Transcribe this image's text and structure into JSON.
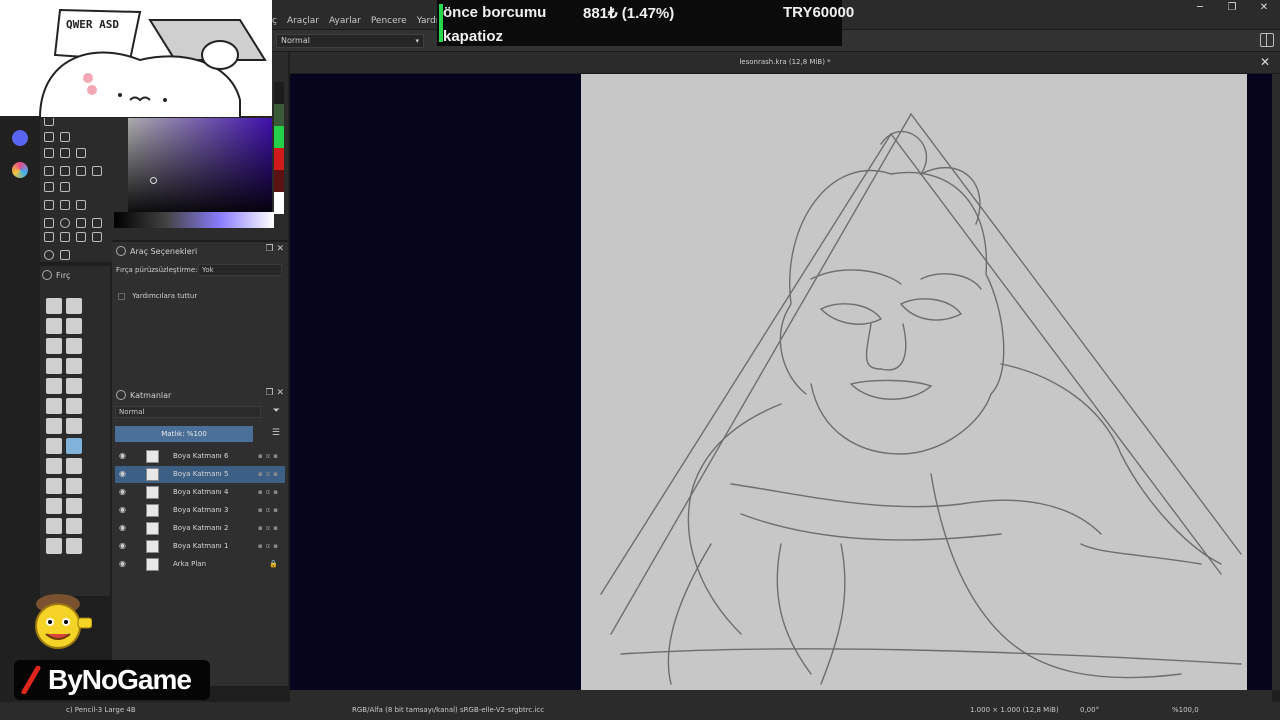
{
  "menu": {
    "items": [
      "Araçlar",
      "Ayarlar",
      "Pencere",
      "Yardım"
    ],
    "partial_item": "ç"
  },
  "window_controls": {
    "minimize": "─",
    "maximize": "❐",
    "close": "✕"
  },
  "toolbar": {
    "blend_mode": "Normal"
  },
  "ticker": {
    "line1_label": "önce borcumu",
    "line1_value": "881₺ (1.47%)",
    "line1_goal": "TRY60000",
    "line2": "kapatioz"
  },
  "tool_options": {
    "title": "Araç Seçenekleri",
    "smoothing_label": "Fırça pürüzsüzleştirme:",
    "smoothing_value": "Yok",
    "assist_label": "Yardımcılara tuttur"
  },
  "brush_presets": {
    "title": "Fırç"
  },
  "layers": {
    "title": "Katmanlar",
    "blend_mode": "Normal",
    "opacity_label": "Matlık: %100",
    "items": [
      {
        "name": "Boya Katmanı 6",
        "active": false,
        "locked": false
      },
      {
        "name": "Boya Katmanı 5",
        "active": true,
        "locked": false
      },
      {
        "name": "Boya Katmanı 4",
        "active": false,
        "locked": false
      },
      {
        "name": "Boya Katmanı 3",
        "active": false,
        "locked": false
      },
      {
        "name": "Boya Katmanı 2",
        "active": false,
        "locked": false
      },
      {
        "name": "Boya Katmanı 1",
        "active": false,
        "locked": false
      },
      {
        "name": "Arka Plan",
        "active": false,
        "locked": true
      }
    ]
  },
  "document": {
    "tab_title": "lesonrash.kra (12,8 MiB) *"
  },
  "statusbar": {
    "brush": "c) Pencil-3 Large 4B",
    "color_profile": "RGB/Alfa (8 bit tamsayı/kanal)  sRGB-elle-V2-srgbtrc.icc",
    "dimensions": "1.000 × 1.000 (12,8 MiB)",
    "rotation": "0,00°",
    "zoom": "%100,0"
  },
  "overlay": {
    "logo_text": "ByNoGame",
    "sticker_keys": "QWER ASD"
  },
  "colors": {
    "accent": "#5c17ff",
    "canvas_bg": "#05051c",
    "paper": "#c7c7c7",
    "active_layer": "#3c5f86",
    "ticker_green": "#25d94a"
  },
  "icons": [
    "chrome-icon",
    "obs-icon",
    "discord-icon",
    "krita-icon",
    "eye-icon",
    "lock-icon",
    "filter-icon",
    "menu-icon",
    "trash-icon"
  ]
}
